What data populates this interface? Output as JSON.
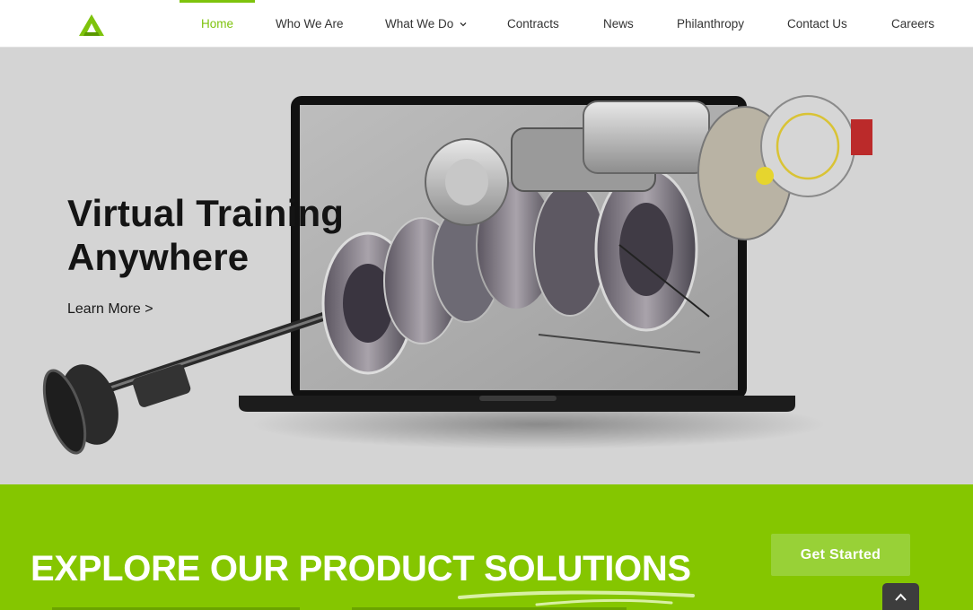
{
  "nav": {
    "items": [
      {
        "label": "Home",
        "active": true
      },
      {
        "label": "Who We Are"
      },
      {
        "label": "What We Do",
        "has_dropdown": true
      },
      {
        "label": "Contracts"
      },
      {
        "label": "News"
      },
      {
        "label": "Philanthropy"
      },
      {
        "label": "Contact Us"
      },
      {
        "label": "Careers"
      }
    ]
  },
  "hero": {
    "title_line1": "Virtual Training",
    "title_line2": "Anywhere",
    "link": "Learn More >"
  },
  "band": {
    "title": "EXPLORE OUR PRODUCT SOLUTIONS",
    "cta": "Get Started"
  },
  "colors": {
    "accent": "#7ec30c",
    "band": "#85c600",
    "hero_bg": "#d4d4d4"
  },
  "icons": [
    "logo-icon",
    "chevron-down-icon",
    "chevron-up-icon"
  ]
}
